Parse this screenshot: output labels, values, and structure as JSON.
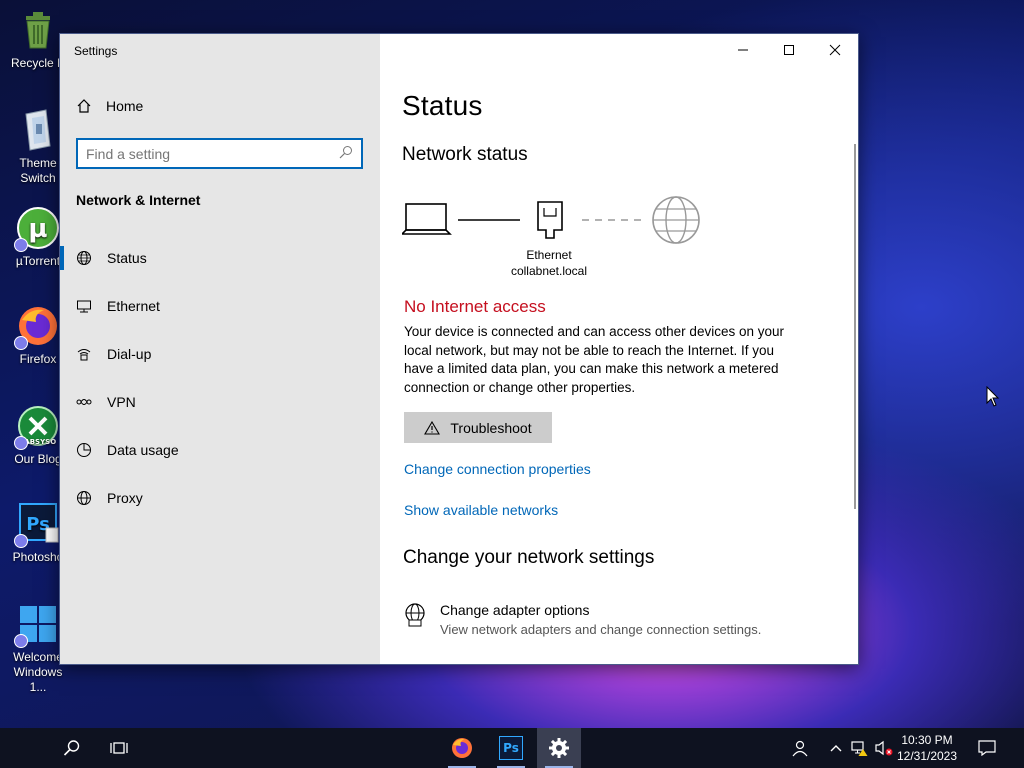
{
  "desktop": {
    "icons": [
      {
        "label": "Recycle B",
        "icon": "recycle-bin-icon"
      },
      {
        "label": "Theme\nSwitch",
        "icon": "theme-switch-icon"
      },
      {
        "label": "µTorrent",
        "icon": "utorrent-icon"
      },
      {
        "label": "Firefox",
        "icon": "firefox-icon"
      },
      {
        "label": "Our Blog",
        "icon": "blog-icon"
      },
      {
        "label": "Photosho",
        "icon": "photoshop-icon"
      },
      {
        "label": "Welcome\nWindows 1...",
        "icon": "windows-icon"
      }
    ],
    "blog_icon_text": "LABSYSO"
  },
  "window": {
    "title": "Settings",
    "sidebar": {
      "home_label": "Home",
      "search_placeholder": "Find a setting",
      "section_heading": "Network & Internet",
      "items": [
        {
          "label": "Status",
          "icon": "globe-icon",
          "active": true
        },
        {
          "label": "Ethernet",
          "icon": "ethernet-icon"
        },
        {
          "label": "Dial-up",
          "icon": "dialup-icon"
        },
        {
          "label": "VPN",
          "icon": "vpn-icon"
        },
        {
          "label": "Data usage",
          "icon": "data-usage-icon"
        },
        {
          "label": "Proxy",
          "icon": "proxy-icon"
        }
      ]
    },
    "main": {
      "page_title": "Status",
      "network_status_heading": "Network status",
      "adapter_name": "Ethernet",
      "network_name": "collabnet.local",
      "status_title": "No Internet access",
      "status_desc": "Your device is connected and can access other devices on your local network, but may not be able to reach the Internet. If you have a limited data plan, you can make this network a metered connection or change other properties.",
      "troubleshoot_label": "Troubleshoot",
      "link_change_properties": "Change connection properties",
      "link_show_networks": "Show available networks",
      "change_settings_heading": "Change your network settings",
      "adapter_options_title": "Change adapter options",
      "adapter_options_desc": "View network adapters and change connection settings."
    }
  },
  "taskbar": {
    "time": "10:30 PM",
    "date": "12/31/2023",
    "photoshop_label": "Ps"
  },
  "colors": {
    "accent": "#0067b8",
    "error": "#c50f1f",
    "sidebar_bg": "#e6e6e6"
  }
}
